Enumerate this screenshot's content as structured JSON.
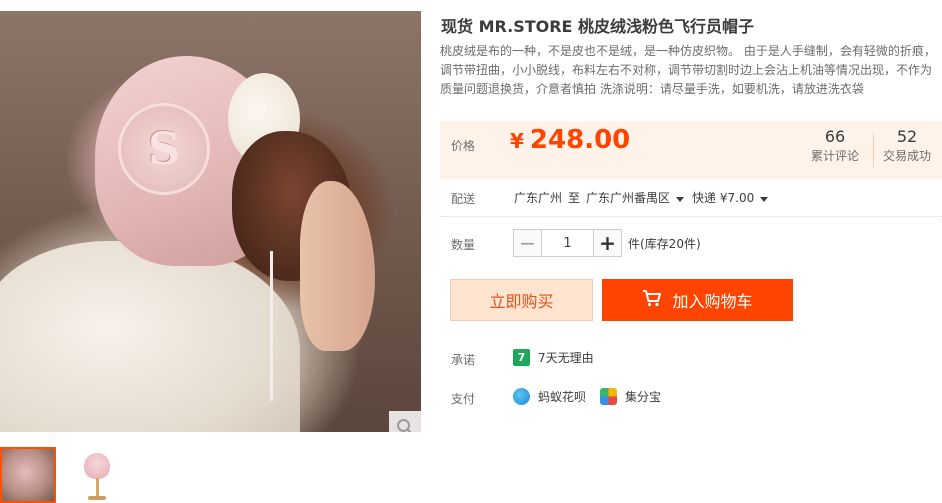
{
  "product": {
    "title": "现货 MR.STORE 桃皮绒浅粉色飞行员帽子",
    "description": "桃皮绒是布的一种，不是皮也不是绒，是一种仿皮织物。 由于是人手缝制，会有轻微的折痕， 调节带扭曲，小小脱线，布料左右不对称，调节带切割时边上会沾上机油等情况出现，不作为质量问题退换货，介意者慎拍 洗涤说明：请尽量手洗，如要机洗，请放进洗衣袋",
    "hat_badge_letter": "S"
  },
  "price": {
    "label": "价格",
    "currency": "¥",
    "value": "248.00"
  },
  "stats": {
    "reviews_count": "66",
    "reviews_label": "累计评论",
    "sold_count": "52",
    "sold_label": "交易成功"
  },
  "shipping": {
    "label": "配送",
    "from": "广东广州",
    "to_word": "至",
    "to": "广东广州番禺区",
    "method": "快递 ¥7.00"
  },
  "quantity": {
    "label": "数量",
    "minus": "−",
    "value": "1",
    "plus": "+",
    "unit_stock": "件(库存20件)"
  },
  "buttons": {
    "buy_now": "立即购买",
    "add_to_cart": "加入购物车"
  },
  "services": {
    "promise_label": "承诺",
    "promise_icon_text": "7",
    "promise_text": "7天无理由",
    "payment_label": "支付",
    "payment_items": [
      {
        "icon": "huabei-icon",
        "text": "蚂蚁花呗"
      },
      {
        "icon": "jifenbao-icon",
        "text": "集分宝"
      }
    ]
  },
  "colors": {
    "accent": "#ff4400",
    "price_bg": "#fff2e8",
    "buy_now_bg": "#ffe4d0"
  }
}
